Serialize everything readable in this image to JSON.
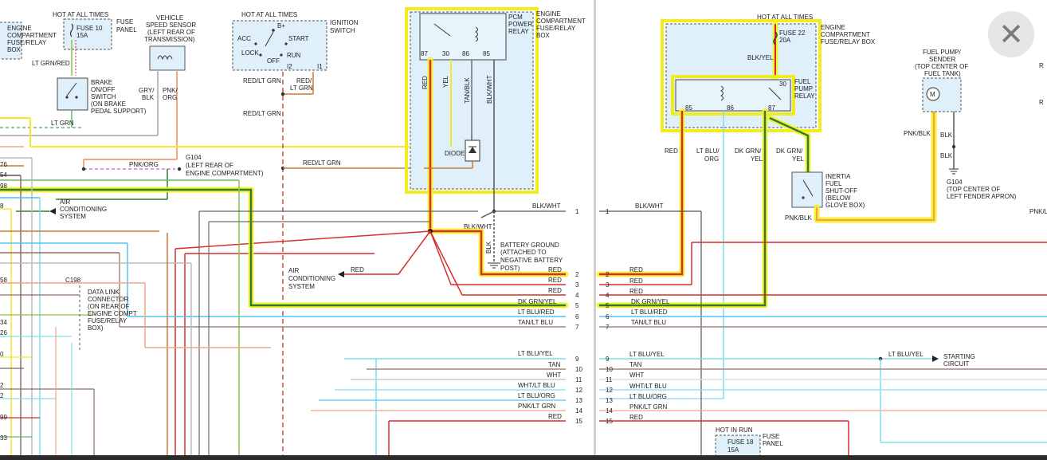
{
  "left": {
    "fuse_panel_hot": "HOT AT ALL TIMES",
    "fuse10": "FUSE 10",
    "fuse10_amp": "15A",
    "fuse_panel": [
      "FUSE",
      "PANEL"
    ],
    "engine_comp_box": [
      "ENGINE",
      "COMPARTMENT",
      "FUSE/RELAY",
      "BOX"
    ],
    "wire_ltgrnred": "LT GRN/RED",
    "brake_switch": [
      "BRAKE",
      "ON/OFF",
      "SWITCH",
      "(ON BRAKE",
      "PEDAL SUPPORT)"
    ],
    "wire_ltgrn": "LT GRN",
    "vss": [
      "VEHICLE",
      "SPEED SENSOR",
      "(LEFT REAR OF",
      "TRANSMISSION)"
    ],
    "wire_grybLK": [
      "GRY/",
      "BLK"
    ],
    "wire_pnkorg_v": [
      "PNK/",
      "ORG"
    ],
    "wire_pnkorg": "PNK/ORG",
    "g104": [
      "G104",
      "(LEFT REAR OF",
      "ENGINE COMPARTMENT)"
    ],
    "ac_system": [
      "AIR",
      "CONDITIONING",
      "SYSTEM"
    ],
    "ign_hot": "HOT AT ALL TIMES",
    "ign_switch": [
      "IGNITION",
      "SWITCH"
    ],
    "ign_pos": {
      "bplus": "B+",
      "acc": "ACC",
      "start": "START",
      "lock": "LOCK",
      "off": "OFF",
      "run": "RUN",
      "i2": "I2",
      "i1": "I1"
    },
    "wire_redltgrn": "RED/LT GRN",
    "wire_redltgrn2": [
      "RED/",
      "LT GRN"
    ],
    "pcm_relay": [
      "PCM",
      "POWER",
      "RELAY"
    ],
    "pins": [
      "87",
      "30",
      "86",
      "85"
    ],
    "wires_v": [
      "RED",
      "YEL",
      "TAN/BLK",
      "BLK/WHT"
    ],
    "diode": "DIODE",
    "wire_blk": "BLK",
    "wire_blkwht": "BLK/WHT",
    "battery_ground": [
      "BATTERY GROUND",
      "(ATTACHED TO",
      "NEGATIVE BATTERY",
      "POST)"
    ],
    "wire_red": "RED",
    "dlc": [
      "DATA LINK",
      "CONNECTOR",
      "(ON REAR OF",
      "ENGINE COMPT",
      "FUSE/RELAY",
      "BOX)"
    ],
    "c198": "C198",
    "edge_nums": [
      "76",
      "54",
      "98",
      "8",
      "58",
      "34",
      "26",
      "0",
      "2",
      "2",
      "99",
      "33"
    ],
    "bus_rows": [
      {
        "label": "BLK/WHT",
        "num": "1"
      },
      {
        "label": "RED",
        "num": "2"
      },
      {
        "label": "RED",
        "num": "3"
      },
      {
        "label": "RED",
        "num": "4"
      },
      {
        "label": "DK GRN/YEL",
        "num": "5"
      },
      {
        "label": "LT BLU/RED",
        "num": "6"
      },
      {
        "label": "TAN/LT BLU",
        "num": "7"
      },
      {
        "label": "LT BLU/YEL",
        "num": "9"
      },
      {
        "label": "TAN",
        "num": "10"
      },
      {
        "label": "WHT",
        "num": "11"
      },
      {
        "label": "WHT/LT BLU",
        "num": "12"
      },
      {
        "label": "LT BLU/ORG",
        "num": "13"
      },
      {
        "label": "PNK/LT GRN",
        "num": "14"
      },
      {
        "label": "RED",
        "num": "15"
      }
    ]
  },
  "right": {
    "hot": "HOT AT ALL TIMES",
    "fuse22": "FUSE 22",
    "fuse22_amp": "20A",
    "engine_comp_box": [
      "ENGINE",
      "COMPARTMENT",
      "FUSE/RELAY BOX"
    ],
    "wire_blkyel": "BLK/YEL",
    "fp_relay": [
      "FUEL",
      "PUMP",
      "RELAY"
    ],
    "pins": [
      "85",
      "86",
      "87",
      "30"
    ],
    "wire_red": "RED",
    "wire_ltbluorg": [
      "LT BLU/",
      "ORG"
    ],
    "wire_dkgrnyel": [
      "DK GRN/",
      "YEL"
    ],
    "wire_dkgrnyel2": [
      "DK GRN/",
      "YEL"
    ],
    "inertia": [
      "INERTIA",
      "FUEL",
      "SHUT-OFF",
      "(BELOW",
      "GLOVE BOX)"
    ],
    "wire_pnkblk": "PNK/BLK",
    "wire_pnkblk2": "PNK/BLK",
    "fuel_pump": [
      "FUEL PUMP/",
      "SENDER",
      "(TOP CENTER OF",
      "FUEL TANK)"
    ],
    "motor": "M",
    "wire_blk": "BLK",
    "wire_blk2": "BLK",
    "g104": [
      "G104",
      "(TOP CENTER OF",
      "LEFT FENDER APRON)"
    ],
    "starting": [
      "STARTING",
      "CIRCUIT"
    ],
    "wire_ltbluyel": "LT BLU/YEL",
    "hot_in_run": "HOT IN RUN",
    "fuse18": "FUSE 18",
    "fuse18_amp": "15A",
    "fuse_panel": [
      "FUSE",
      "PANEL"
    ],
    "edge_labels": [
      "R",
      "R",
      "PNK/L"
    ],
    "bus_rows": [
      {
        "label": "BLK/WHT",
        "num": "1"
      },
      {
        "label": "RED",
        "num": "2"
      },
      {
        "label": "RED",
        "num": "3"
      },
      {
        "label": "RED",
        "num": "4"
      },
      {
        "label": "DK GRN/YEL",
        "num": "5"
      },
      {
        "label": "LT BLU/RED",
        "num": "6"
      },
      {
        "label": "TAN/LT BLU",
        "num": "7"
      },
      {
        "label": "LT BLU/YEL",
        "num": "9"
      },
      {
        "label": "TAN",
        "num": "10"
      },
      {
        "label": "WHT",
        "num": "11"
      },
      {
        "label": "WHT/LT BLU",
        "num": "12"
      },
      {
        "label": "LT BLU/ORG",
        "num": "13"
      },
      {
        "label": "PNK/LT GRN",
        "num": "14"
      },
      {
        "label": "RED",
        "num": "15"
      }
    ]
  },
  "close_icon": "close-icon"
}
